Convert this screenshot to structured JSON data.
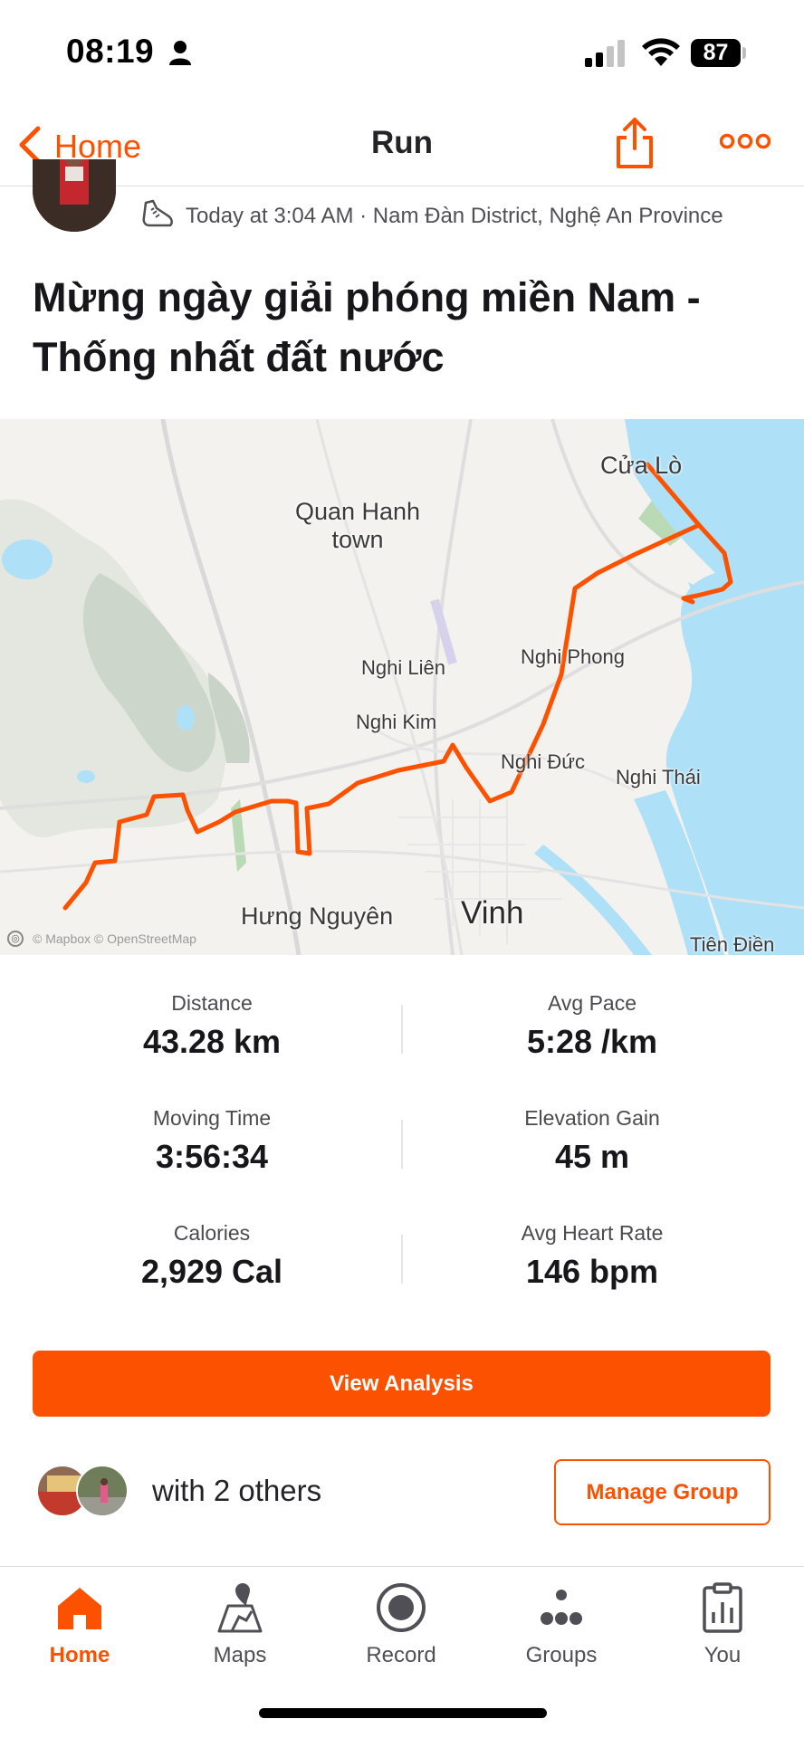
{
  "status_bar": {
    "time": "08:19",
    "battery": "87"
  },
  "nav": {
    "back_label": "Home",
    "title": "Run"
  },
  "activity": {
    "meta": "Today at 3:04 AM · Nam Đàn District, Nghệ An Province",
    "title": "Mừng ngày giải phóng miền Nam - Thống nhất đất nước"
  },
  "map": {
    "labels": {
      "cua_lo": "Cửa Lò",
      "quan_hanh": "Quan Hanh town",
      "nghi_lien": "Nghi Liên",
      "nghi_phong": "Nghi Phong",
      "nghi_kim": "Nghi Kim",
      "nghi_duc": "Nghi Đức",
      "nghi_thai": "Nghi Thái",
      "hung_nguyen": "Hưng Nguyên",
      "vinh": "Vinh",
      "tien_dien": "Tiên Điền"
    },
    "attribution": "© Mapbox © OpenStreetMap",
    "route_color": "#fc5200"
  },
  "stats": {
    "distance": {
      "label": "Distance",
      "value": "43.28 km"
    },
    "avg_pace": {
      "label": "Avg Pace",
      "value": "5:28 /km"
    },
    "moving_time": {
      "label": "Moving Time",
      "value": "3:56:34"
    },
    "elevation_gain": {
      "label": "Elevation Gain",
      "value": "45 m"
    },
    "calories": {
      "label": "Calories",
      "value": "2,929 Cal"
    },
    "avg_heart_rate": {
      "label": "Avg Heart Rate",
      "value": "146 bpm"
    }
  },
  "actions": {
    "view_analysis": "View Analysis",
    "manage_group": "Manage Group"
  },
  "group": {
    "text": "with 2 others"
  },
  "tabs": {
    "home": "Home",
    "maps": "Maps",
    "record": "Record",
    "groups": "Groups",
    "you": "You"
  },
  "colors": {
    "accent": "#fc5200",
    "water": "#aee0f7",
    "text": "#242428"
  }
}
